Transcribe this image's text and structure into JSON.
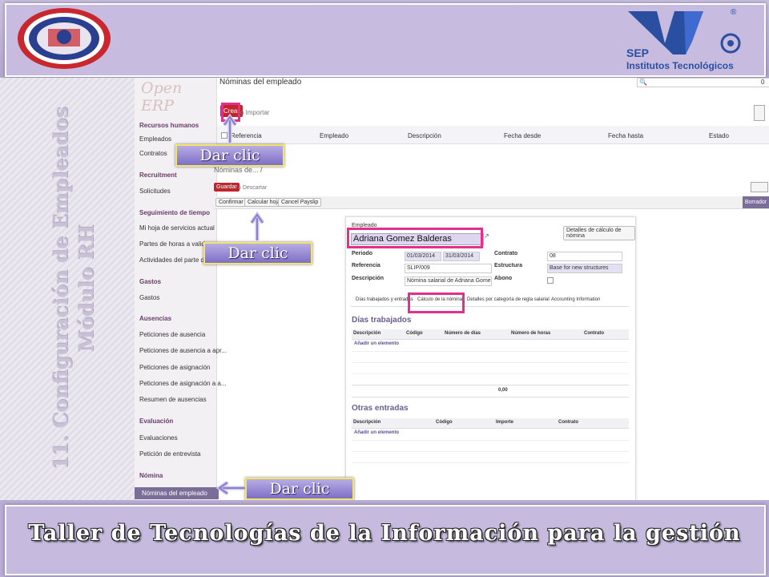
{
  "slide": {
    "footer_title": "Taller de Tecnologías de la Información para la gestión",
    "vertical_title_line1": "11. Configuración de Empleados",
    "vertical_title_line2": "Módulo RH",
    "callout_label": "Dar clic",
    "logos": {
      "left": "instituto-tecnologico-seal",
      "right_text1": "SEP",
      "right_text2": "Institutos Tecnológicos",
      "right_mark": "®"
    }
  },
  "app": {
    "brand": "Open ERP",
    "sidebar": [
      {
        "label": "Recursos humanos",
        "type": "header"
      },
      {
        "label": "Empleados",
        "type": "item"
      },
      {
        "label": "Contratos",
        "type": "item"
      },
      {
        "label": "Recruitment",
        "type": "header"
      },
      {
        "label": "Solicitudes",
        "type": "item"
      },
      {
        "label": "Seguimiento de tiempo",
        "type": "header"
      },
      {
        "label": "Mi hoja de servicios actual",
        "type": "item"
      },
      {
        "label": "Partes de horas a validar",
        "type": "item"
      },
      {
        "label": "Actividades del parte de horas",
        "type": "item"
      },
      {
        "label": "Gastos",
        "type": "header"
      },
      {
        "label": "Gastos",
        "type": "item"
      },
      {
        "label": "Ausencias",
        "type": "header"
      },
      {
        "label": "Peticiones de ausencia",
        "type": "item"
      },
      {
        "label": "Peticiones de ausencia a apr...",
        "type": "item"
      },
      {
        "label": "Peticiones de asignación",
        "type": "item"
      },
      {
        "label": "Peticiones de asignación a a...",
        "type": "item"
      },
      {
        "label": "Resumen de ausencias",
        "type": "item"
      },
      {
        "label": "Evaluación",
        "type": "header"
      },
      {
        "label": "Evaluaciones",
        "type": "item"
      },
      {
        "label": "Petición de entrevista",
        "type": "item"
      },
      {
        "label": "Nómina",
        "type": "header"
      },
      {
        "label": "Nóminas del empleado",
        "type": "active"
      }
    ],
    "list": {
      "title": "Nóminas del empleado",
      "create": "Crear",
      "import": "o Importar",
      "search_end": "0",
      "columns": [
        "Referencia",
        "Empleado",
        "Descripción",
        "Fecha desde",
        "Fecha hasta",
        "Estado"
      ]
    },
    "form": {
      "breadcrumb": "Nóminas de... /",
      "save": "Guardar",
      "discard": "o Descartar",
      "buttons": [
        "Confirmar",
        "Calcular hoja",
        "Cancel Payslip"
      ],
      "state": "Borrador",
      "employee_label": "Empleado",
      "employee": "Adriana Gomez Balderas",
      "details_button": "Detalles de cálculo de nómina",
      "period_label": "Periodo",
      "date_from": "01/03/2014",
      "date_to": "31/03/2014",
      "reference_label": "Referencia",
      "reference": "SLIP/009",
      "description_label": "Descripción",
      "description": "Nómina salarial de Adriana Gomez Balderas",
      "contract_label": "Contrato",
      "contract": "08",
      "structure_label": "Estructura",
      "structure": "Base for new structures",
      "refund_label": "Abono",
      "tabs": [
        "Días trabajados y entradas",
        "Cálculo de la nómina",
        "Detalles por categoría de regla salarial",
        "Accounting Information"
      ],
      "worked_title": "Días trabajados",
      "worked_cols": [
        "Descripción",
        "Código",
        "Número de días",
        "Número de horas",
        "Contrato"
      ],
      "add_item": "Añadir un elemento",
      "total": "0,00",
      "other_title": "Otras entradas",
      "other_cols": [
        "Descripción",
        "Código",
        "Importe",
        "Contrato"
      ]
    }
  },
  "colors": {
    "accent": "#e2318d",
    "primary": "#c0252c",
    "callout": "#8b7fd0",
    "border": "#f2e56a"
  }
}
